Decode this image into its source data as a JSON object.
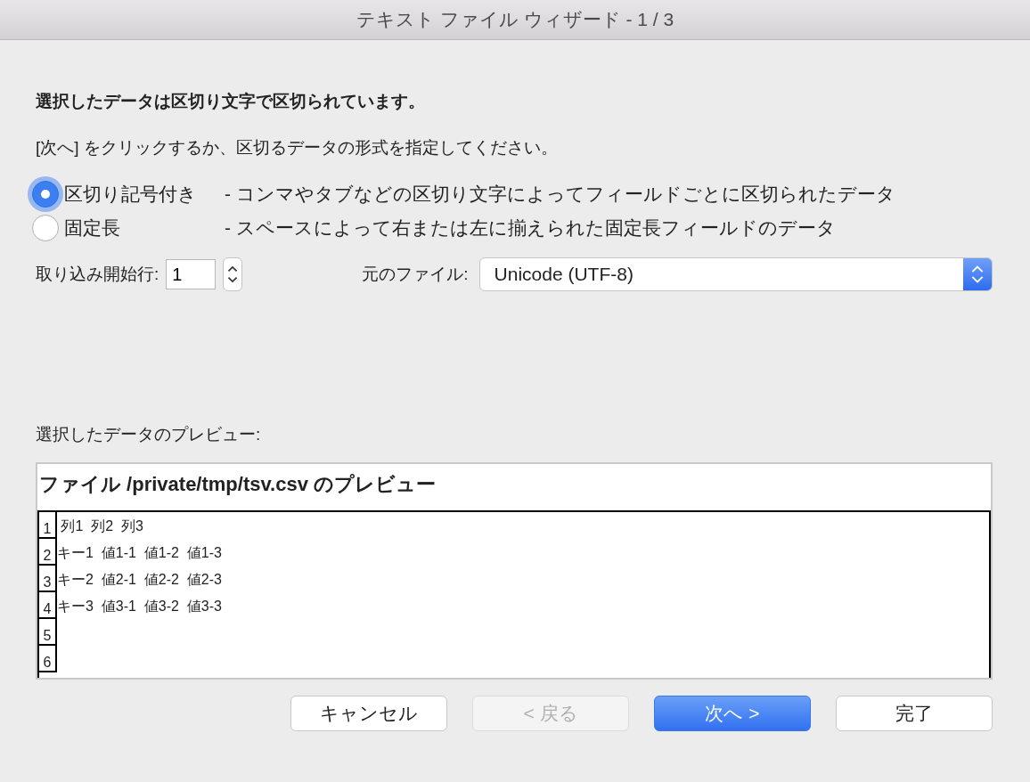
{
  "window": {
    "title": "テキスト ファイル ウィザード - 1 / 3"
  },
  "heading": "選択したデータは区切り文字で区切られています。",
  "instruction": "[次へ] をクリックするか、区切るデータの形式を指定してください。",
  "data_types": [
    {
      "label": "区切り記号付き",
      "description": "- コンマやタブなどの区切り文字によってフィールドごとに区切られたデータ",
      "selected": true
    },
    {
      "label": "固定長",
      "description": "- スペースによって右または左に揃えられた固定長フィールドのデータ",
      "selected": false
    }
  ],
  "start_row": {
    "label": "取り込み開始行:",
    "value": "1"
  },
  "file_origin": {
    "label": "元のファイル:",
    "value": "Unicode (UTF-8)"
  },
  "preview": {
    "label": "選択したデータのプレビュー:",
    "title": "ファイル /private/tmp/tsv.csv のプレビュー",
    "rows": [
      {
        "number": "1",
        "text": " 列1  列2  列3"
      },
      {
        "number": "2",
        "text": "キー1  値1-1  値1-2  値1-3"
      },
      {
        "number": "3",
        "text": "キー2  値2-1  値2-2  値2-3"
      },
      {
        "number": "4",
        "text": "キー3  値3-1  値3-2  値3-3"
      },
      {
        "number": "5",
        "text": ""
      },
      {
        "number": "6",
        "text": ""
      }
    ]
  },
  "buttons": [
    {
      "label": "キャンセル",
      "kind": "default",
      "disabled": false
    },
    {
      "label": "< 戻る",
      "kind": "default",
      "disabled": true
    },
    {
      "label": "次へ >",
      "kind": "primary",
      "disabled": false
    },
    {
      "label": "完了",
      "kind": "default",
      "disabled": false
    }
  ]
}
